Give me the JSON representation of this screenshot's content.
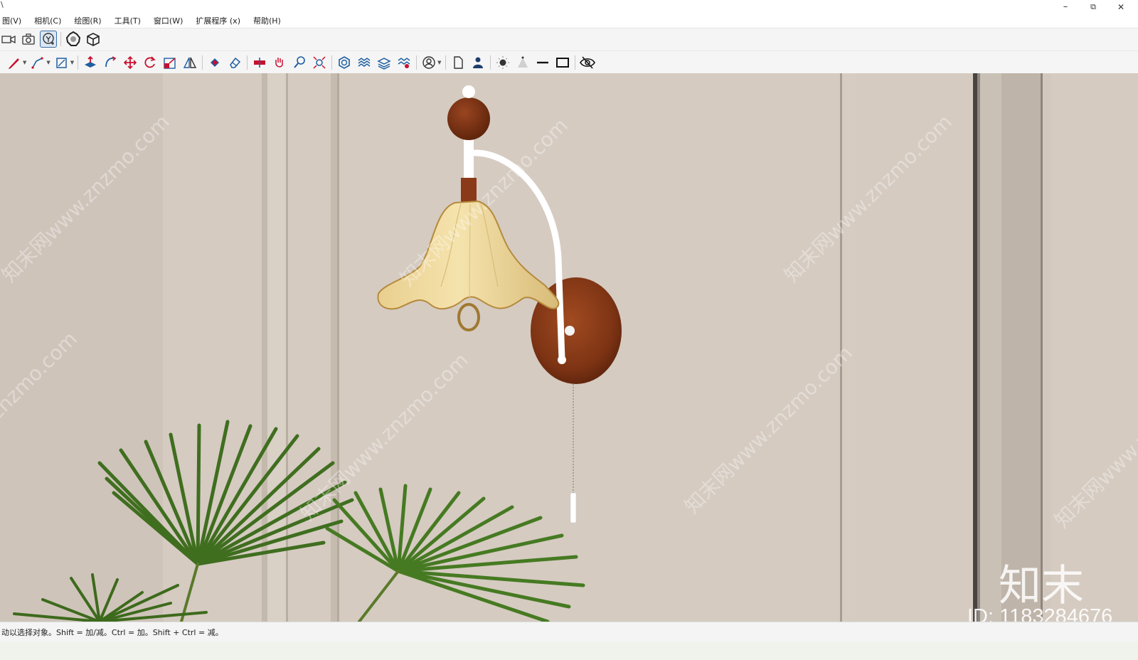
{
  "window": {
    "title_glyph": "\\",
    "minimize": "–",
    "restore": "⧉",
    "close": "✕"
  },
  "menu": {
    "items": [
      "图(V)",
      "相机(C)",
      "绘图(R)",
      "工具(T)",
      "窗口(W)",
      "扩展程序 (x)",
      "帮助(H)"
    ]
  },
  "toolbar1": {
    "icons": [
      "video-camera-icon",
      "camera-icon",
      "orbit-icon",
      "component-icon",
      "box-icon"
    ]
  },
  "toolbar2": {
    "icons": [
      "pencil-icon",
      "polyline-icon",
      "rectangle-icon",
      "push-pull-icon",
      "follow-me-icon",
      "move-icon",
      "rotate-icon",
      "scale-icon",
      "flip-icon",
      "paint-bucket-icon",
      "eraser-icon",
      "section-icon",
      "pan-icon",
      "zoom-icon",
      "zoom-extents-icon",
      "soften-icon",
      "layers-icon",
      "stack-icon",
      "tags-icon",
      "user-icon",
      "page-icon",
      "person-icon",
      "sun-icon",
      "shadow-icon",
      "line-icon",
      "frame-icon",
      "hidden-icon"
    ]
  },
  "viewport": {
    "watermark": "知末网www.znzmo.com",
    "brand": "知末",
    "id_text": "ID: 1183284676",
    "colors": {
      "wall": "#d5cbc1",
      "wall_left": "#cec3b8",
      "wood": "#8a3a18",
      "shade": "#f1dca2",
      "arm": "#ffffff",
      "leaf": "#3f6e1f"
    }
  },
  "status": {
    "text": "动以选择对象。Shift = 加/减。Ctrl = 加。Shift + Ctrl = 减。"
  }
}
